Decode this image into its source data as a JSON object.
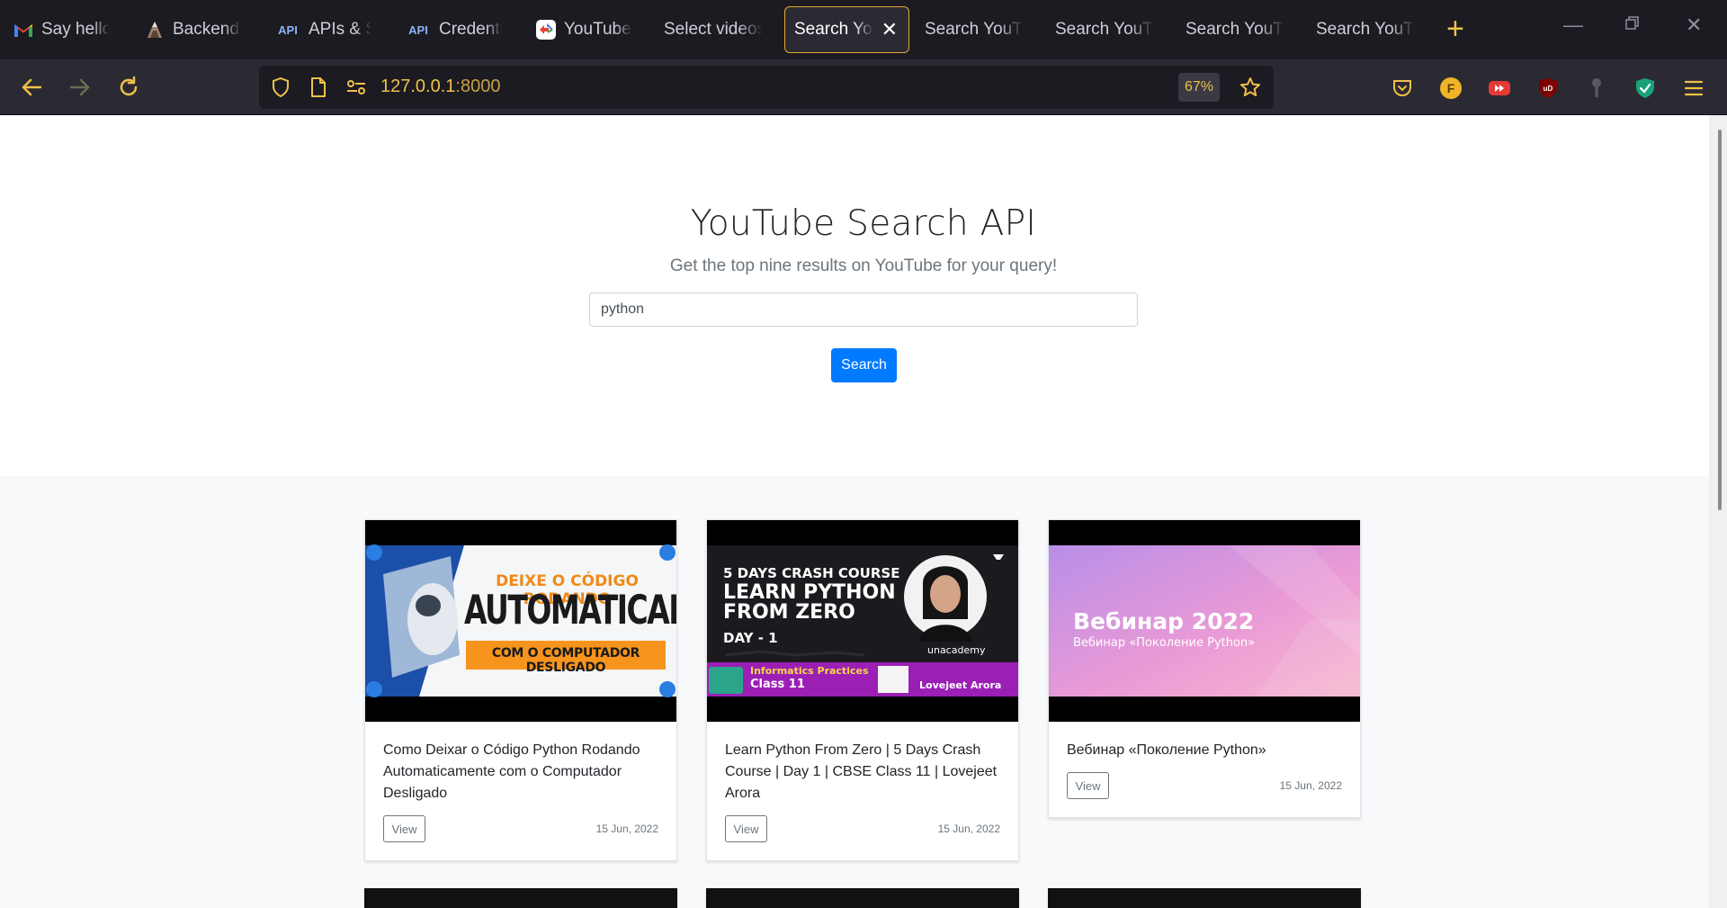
{
  "browser": {
    "tabs": [
      {
        "label": "Say hello",
        "icon": "gmail-icon"
      },
      {
        "label": "Backend A",
        "icon": "volcano-icon"
      },
      {
        "label": "APIs & Se",
        "icon": "api-icon",
        "icon_text": "API"
      },
      {
        "label": "Credential",
        "icon": "api-icon",
        "icon_text": "API"
      },
      {
        "label": "YouTube D",
        "icon": "google-cloud-icon"
      },
      {
        "label": "Select videos",
        "icon": ""
      },
      {
        "label": "Search You",
        "icon": "",
        "active": true
      },
      {
        "label": "Search YouTu",
        "icon": ""
      },
      {
        "label": "Search YouTu",
        "icon": ""
      },
      {
        "label": "Search YouTu",
        "icon": ""
      },
      {
        "label": "Search YouTu",
        "icon": ""
      }
    ],
    "new_tab": "+",
    "url_host": "127.0.0.1",
    "url_port": ":8000",
    "zoom": "67%",
    "accent_color": "#f0c048"
  },
  "hero": {
    "title": "YouTube Search API",
    "subtitle": "Get the top nine results on YouTube for your query!",
    "query_value": "python",
    "search_label": "Search"
  },
  "results": [
    {
      "title": "Como Deixar o Código Python Rodando Automaticamente com o Computador Desligado",
      "view_label": "View",
      "date": "15 Jun, 2022",
      "thumb": {
        "line1": "DEIXE O CÓDIGO RODANDO",
        "line2": "AUTOMATICAMENTE",
        "line3": "COM O COMPUTADOR DESLIGADO"
      }
    },
    {
      "title": "Learn Python From Zero | 5 Days Crash Course | Day 1 | CBSE Class 11 | Lovejeet Arora",
      "view_label": "View",
      "date": "15 Jun, 2022",
      "thumb": {
        "line1": "5 DAYS CRASH COURSE",
        "line2": "LEARN PYTHON",
        "line3": "FROM ZERO",
        "line4": "DAY - 1",
        "line5": "Informatics Practices",
        "line6": "Class 11",
        "brand": "unacademy",
        "presenter": "Lovejeet Arora"
      }
    },
    {
      "title": "Вебинар «Поколение Python»",
      "view_label": "View",
      "date": "15 Jun, 2022",
      "thumb": {
        "line1": "Вебинар 2022",
        "line2": "Вебинар «Поколение Python»"
      }
    }
  ]
}
